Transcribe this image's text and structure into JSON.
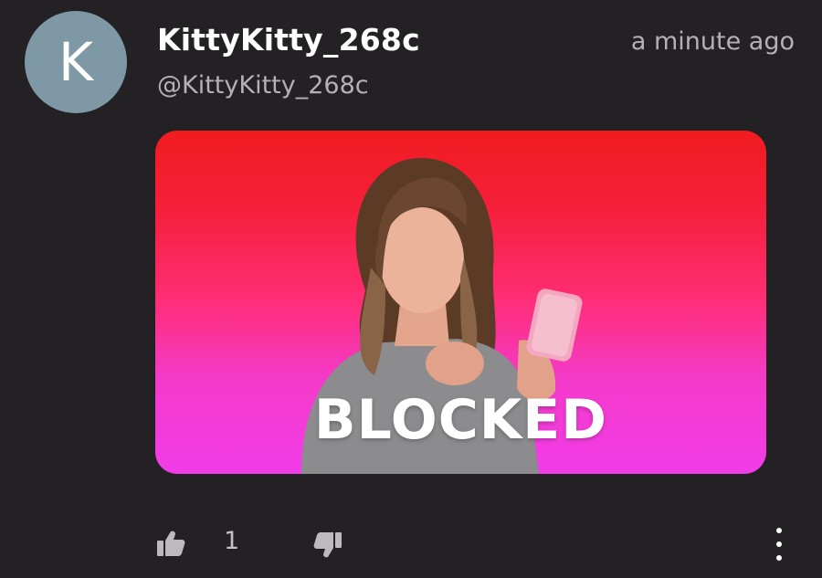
{
  "post": {
    "avatar_letter": "K",
    "display_name": "KittyKitty_268c",
    "handle": "@KittyKitty_268c",
    "timestamp": "a minute ago",
    "gif": {
      "caption": "BLOCKED"
    }
  },
  "actions": {
    "like_icon": "thumbs-up-icon",
    "like_count": "1",
    "dislike_icon": "thumbs-down-icon",
    "more_icon": "more-vertical-icon"
  },
  "colors": {
    "background": "#232124",
    "avatar": "#7e98a5",
    "muted_text": "#b4b1b5",
    "gif_top": "#f01c1f",
    "gif_bottom": "#f23ce9"
  }
}
